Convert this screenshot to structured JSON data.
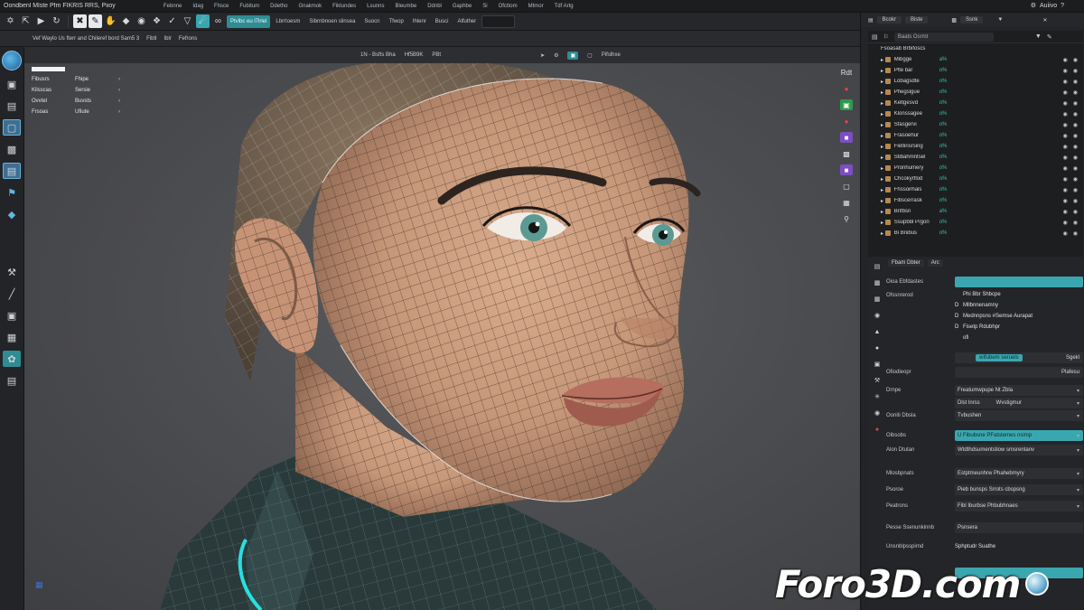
{
  "app": {
    "title": "Oondbenl Mlste Pfm FIKRIS RRS, Piioy",
    "user_name": "Auiivo"
  },
  "menu": [
    "Febnne",
    "Idag",
    "Fhsce",
    "Fubitum",
    "Ddetho",
    "Gnakmok",
    "Fiktundes",
    "Lsunns",
    "Bleumbe",
    "Ddnbl",
    "Gaphbe",
    "Si",
    "Ofcttom",
    "Mtmor",
    "Tdf Artg"
  ],
  "toolbar": {
    "field_teal": "Ptvlbc eu l7lrlel",
    "field_a": "Lbrrtoesm",
    "field_b": "Sibrnbnoen slinsea",
    "field_c": "Suocn",
    "field_d": "Tfwop",
    "field_e": "Ihlenr",
    "field_f": "Busci",
    "field_g": "Alfuther"
  },
  "toolbar2": {
    "hint": "Vef Waylo Us fterr and Chileref bord Sam5 3",
    "field_a": "Fibtl",
    "field_b": "Iblr",
    "field_c": "Fefrons"
  },
  "viewport": {
    "header_a": "1N - Bsfts Bha",
    "header_b": "Hf5B9K",
    "header_c": "PBt",
    "header_right": "Pifslhxe",
    "menu": [
      {
        "a": "Fibusrs",
        "b": "Fhipe"
      },
      {
        "a": "Kilsscas",
        "b": "Sersie"
      },
      {
        "a": "Ovvtel",
        "b": "Buvsts"
      },
      {
        "a": "Frsoas",
        "b": "Ufiute"
      }
    ],
    "corner_label": "Rdt"
  },
  "outliner": {
    "top_tab_a": "Bcokr",
    "top_tab_b": "Biste",
    "top_tab_c": "Ssnk",
    "search_label": "Baats Osrmt",
    "header_name": "Fsoasab Brbifoscs",
    "rows": [
      {
        "name": "Mibgge",
        "mod": "a%"
      },
      {
        "name": "Pfle bar",
        "mod": "o%"
      },
      {
        "name": "Lobagsdte",
        "mod": "o%"
      },
      {
        "name": "Phegslgue",
        "mod": "o%"
      },
      {
        "name": "Keltgesvd",
        "mod": "o%"
      },
      {
        "name": "Klonssagee",
        "mod": "o%"
      },
      {
        "name": "Sfasgervi",
        "mod": "o%"
      },
      {
        "name": "Frasoehur",
        "mod": "o%"
      },
      {
        "name": "Fletlinsrsing",
        "mod": "o%"
      },
      {
        "name": "Stibahmntsel",
        "mod": "o%"
      },
      {
        "name": "Pronhumery",
        "mod": "o%"
      },
      {
        "name": "Chcokyrflod",
        "mod": "o%"
      },
      {
        "name": "Fhssoirhals",
        "mod": "o%"
      },
      {
        "name": "Fibscerrask",
        "mod": "o%"
      },
      {
        "name": "Brifbsn",
        "mod": "a%"
      },
      {
        "name": "Ssupbbl P/gon",
        "mod": "o%"
      },
      {
        "name": "Bi Bnibus",
        "mod": "o%"
      }
    ]
  },
  "properties": {
    "tab_a": "Fbam Dbter",
    "tab_b": "Arc",
    "row1_label": "Oioa Ebfdastes",
    "row2_label": "Ofssnrerod",
    "list": [
      {
        "icon": "",
        "text": "Phi Bbr Shbcpe"
      },
      {
        "icon": "D",
        "text": "Mllbnnenamny"
      },
      {
        "icon": "D",
        "text": "Mednnpsns #Semse Aurapat"
      },
      {
        "icon": "D",
        "text": "Fisetp Rdubhpr"
      },
      {
        "icon": "",
        "text": "ofi"
      }
    ],
    "teal_button": "wIfubem seruels",
    "teal_value": "Sgekl",
    "value_field": "Plafesu",
    "row3_label": "Ofiodleopr",
    "row4_label": "Drnpe",
    "row4_value": "Freatumwpupe Nt Zbla",
    "row5_label": "Ooniti Dbsla",
    "row5_value_a": "Dlst lnrss",
    "row5_value_b": "Wvstigmur",
    "row5_value_c": "Tvbushen",
    "row6_label": "Oibsobs",
    "row6_value": "U Fibubsne PFatstemes nsimp",
    "row7_label": "Alon Dtutan",
    "row7_value": "Wtdthdsumentstiow smsrentanv",
    "row8_label": "Mlosbpnats",
    "row8_value": "Estptmeunhrw Phahebmyry",
    "row9_label": "Psoroe",
    "row9_value": "Pieb bunsps Srrots cbspsng",
    "row10_label": "Peatrons",
    "row10_value": "Fibl Iburbse Phbubhnaes",
    "row11_label": "Pesse Ssenunkinnb",
    "row11_value": "Psnsera",
    "row12_label": "Unsnblpsspirnd",
    "row12_value": "Sphptudr Suathe"
  },
  "watermark": {
    "text": "Foro3D.com"
  }
}
